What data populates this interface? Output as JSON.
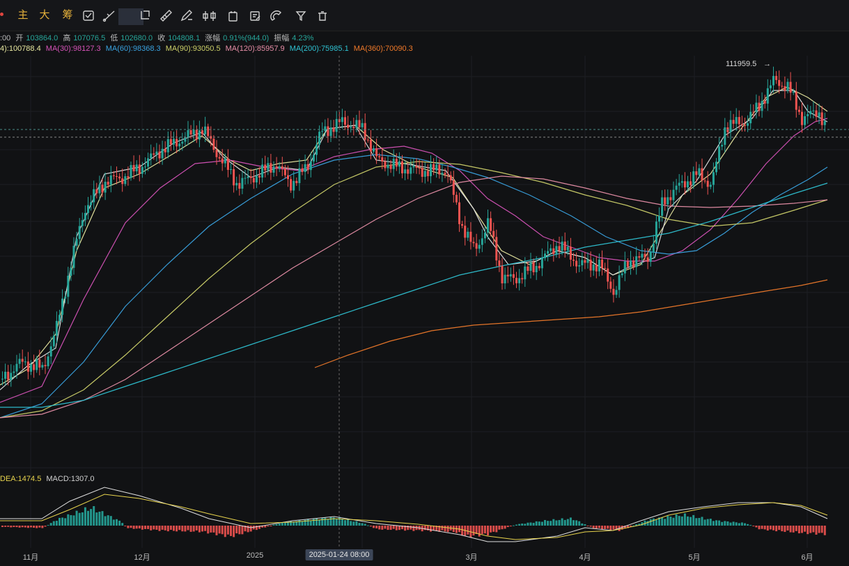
{
  "toolbar": {
    "items": [
      "主",
      "大",
      "筹"
    ],
    "icons": [
      "replay-icon",
      "crossline-tool-icon",
      "rectangle-tool-icon",
      "ruler-tool-icon",
      "pen-tool-icon",
      "candle-style-icon",
      "calendar-icon",
      "note-icon",
      "magnet-icon",
      "filter-icon",
      "trash-icon"
    ]
  },
  "ohlc": {
    "time": ":00",
    "open_label": "开",
    "open": "103864.0",
    "high_label": "高",
    "high": "107076.5",
    "low_label": "低",
    "low": "102680.0",
    "close_label": "收",
    "close": "104808.1",
    "change_label": "涨幅",
    "change": "0.91%(944.0)",
    "amp_label": "振幅",
    "amp": "4.23%"
  },
  "ma": {
    "ma_first": "4):100788.4",
    "ma30": "MA(30):98127.3",
    "ma60": "MA(60):98368.3",
    "ma90": "MA(90):93050.5",
    "ma120": "MA(120):85957.9",
    "ma200": "MA(200):75985.1",
    "ma360": "MA(360):70090.3"
  },
  "macd": {
    "dea": "DEA:1474.5",
    "macd": "MACD:1307.0"
  },
  "peak_label": "111959.5",
  "xaxis": {
    "labels": [
      "11月",
      "12月",
      "2025",
      "3月",
      "4月",
      "5月",
      "6月"
    ],
    "crosshair": "2025-01-24 08:00"
  },
  "colors": {
    "up": "#26a69a",
    "down": "#ef5350",
    "ma_first": "#e8e8a0",
    "ma30": "#d653b8",
    "ma60": "#3aa3e0",
    "ma90": "#cfd26a",
    "ma120": "#e88fa8",
    "ma200": "#2fc3d3",
    "ma360": "#f07a2a"
  }
}
